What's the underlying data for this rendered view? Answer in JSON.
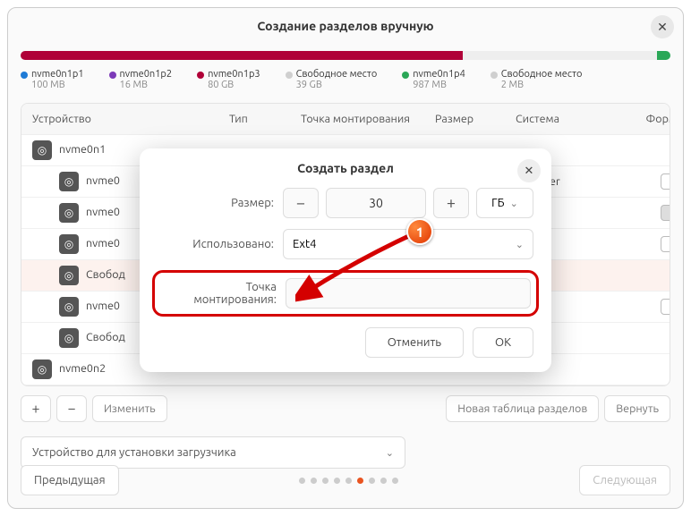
{
  "title": "Создание разделов вручную",
  "partitions": [
    {
      "name": "nvme0n1p1",
      "size": "100 MB",
      "color": "#1e7bd6"
    },
    {
      "name": "nvme0n1p2",
      "size": "16 MB",
      "color": "#7c3ab8"
    },
    {
      "name": "nvme0n1p3",
      "size": "80 GB",
      "color": "#b00038",
      "width": "68%"
    },
    {
      "name": "Свободное место",
      "size": "39 GB",
      "color": "#cfcfcf"
    },
    {
      "name": "nvme0n1p4",
      "size": "987 MB",
      "color": "#2aa757",
      "width": "2%",
      "right": true
    },
    {
      "name": "Свободное место",
      "size": "2 MB",
      "color": "#cfcfcf"
    }
  ],
  "columns": {
    "device": "Устройство",
    "type": "Тип",
    "mount": "Точка монтирования",
    "size": "Размер",
    "system": "Система",
    "format": "Форм"
  },
  "rows": {
    "disk0": "nvme0n1",
    "p1": "nvme0",
    "p2": "nvme0",
    "p3": "nvme0",
    "free1": "Свобод",
    "p4": "nvme0",
    "free2": "Свобод",
    "disk1": "nvme0n2",
    "sys_manager": "Manager"
  },
  "buttons": {
    "change": "Изменить",
    "newtable": "Новая таблица разделов",
    "revert": "Вернуть",
    "prev": "Предыдущая",
    "next": "Следующая"
  },
  "bootloader": "Устройство для установки загрузчика",
  "modal": {
    "title": "Создать раздел",
    "size_label": "Размер:",
    "size_value": "30",
    "unit": "ГБ",
    "used_label": "Использовано:",
    "used_value": "Ext4",
    "mount_label": "Точка монтирования:",
    "cancel": "Отменить",
    "ok": "ОК"
  },
  "annotation": {
    "badge": "1"
  }
}
